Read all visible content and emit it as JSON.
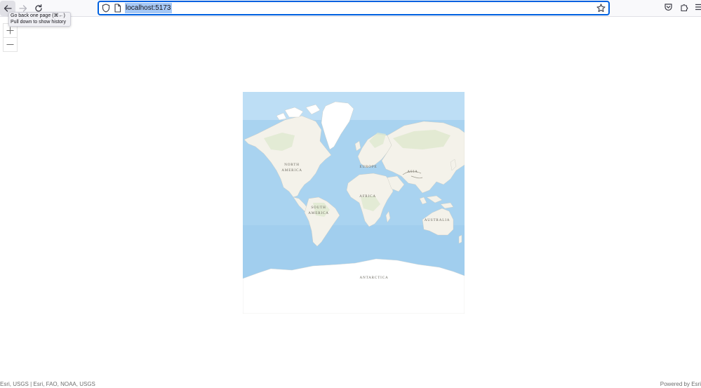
{
  "browser": {
    "url": "localhost:5173",
    "tooltip": {
      "line1": "Go back one page (⌘←)",
      "line2": "Pull down to show history"
    },
    "icons": {
      "back": "arrow-left-icon",
      "forward": "arrow-right-icon",
      "reload": "reload-icon",
      "shield": "shield-icon",
      "page": "page-icon",
      "bookmark": "star-icon",
      "pocket": "pocket-icon",
      "extensions": "puzzle-icon",
      "menu": "hamburger-menu-icon"
    },
    "accent_color": "#0061e0",
    "selection_color": "#a6c8f5"
  },
  "map": {
    "zoom_controls": {
      "zoom_in_icon": "plus-icon",
      "zoom_out_icon": "minus-icon"
    },
    "labels": {
      "north_america_1": "NORTH",
      "north_america_2": "AMERICA",
      "south_america_1": "SOUTH",
      "south_america_2": "AMERICA",
      "europe": "EUROPE",
      "asia": "ASIA",
      "africa": "AFRICA",
      "australia": "AUSTRALIA",
      "antarctica": "ANTARCTICA"
    },
    "colors": {
      "ocean": "#a9d3f0",
      "deep_ocean": "#9ccbec",
      "land": "#f4f2ea",
      "vegetation": "#dfe9cf",
      "ice": "#ffffff",
      "label": "#6d6a60"
    }
  },
  "attribution": {
    "credits": "Esri, USGS | Esri, FAO, NOAA, USGS",
    "powered_by": "Powered by Esri"
  }
}
